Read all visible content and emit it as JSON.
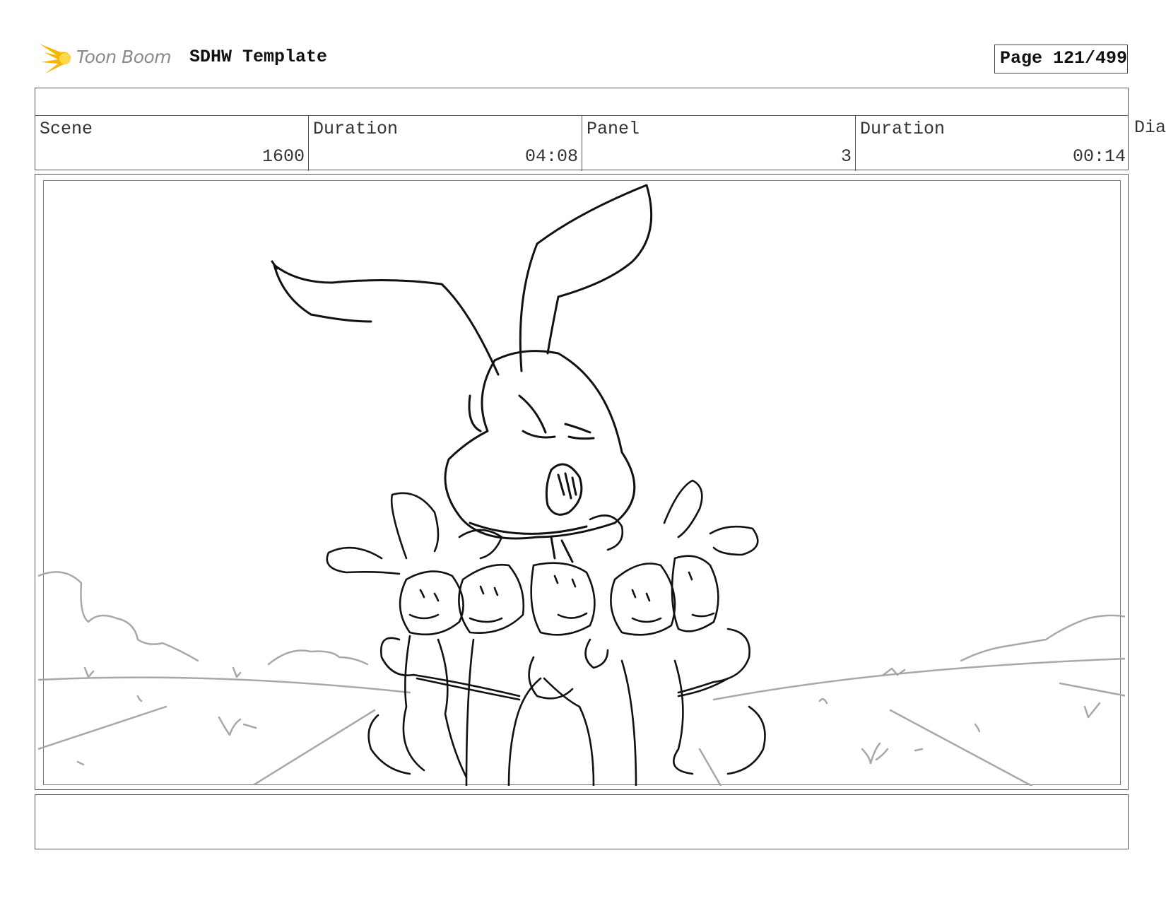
{
  "header": {
    "logo_text": "Toon Boom",
    "document_title": "SDHW Template",
    "page_label": "Page 121/499"
  },
  "info": {
    "scene_label": "Scene",
    "scene_value": "1600",
    "scene_duration_label": "Duration",
    "scene_duration_value": "04:08",
    "panel_label": "Panel",
    "panel_value": "3",
    "panel_duration_label": "Duration",
    "panel_duration_value": "00:14",
    "extra_label": "Dia"
  },
  "colors": {
    "logo_accent": "#f5b800",
    "sketch_ink": "#111111",
    "background_ink": "#a8a8a8"
  },
  "icons": {
    "logo": "toon-boom-logo-icon"
  }
}
